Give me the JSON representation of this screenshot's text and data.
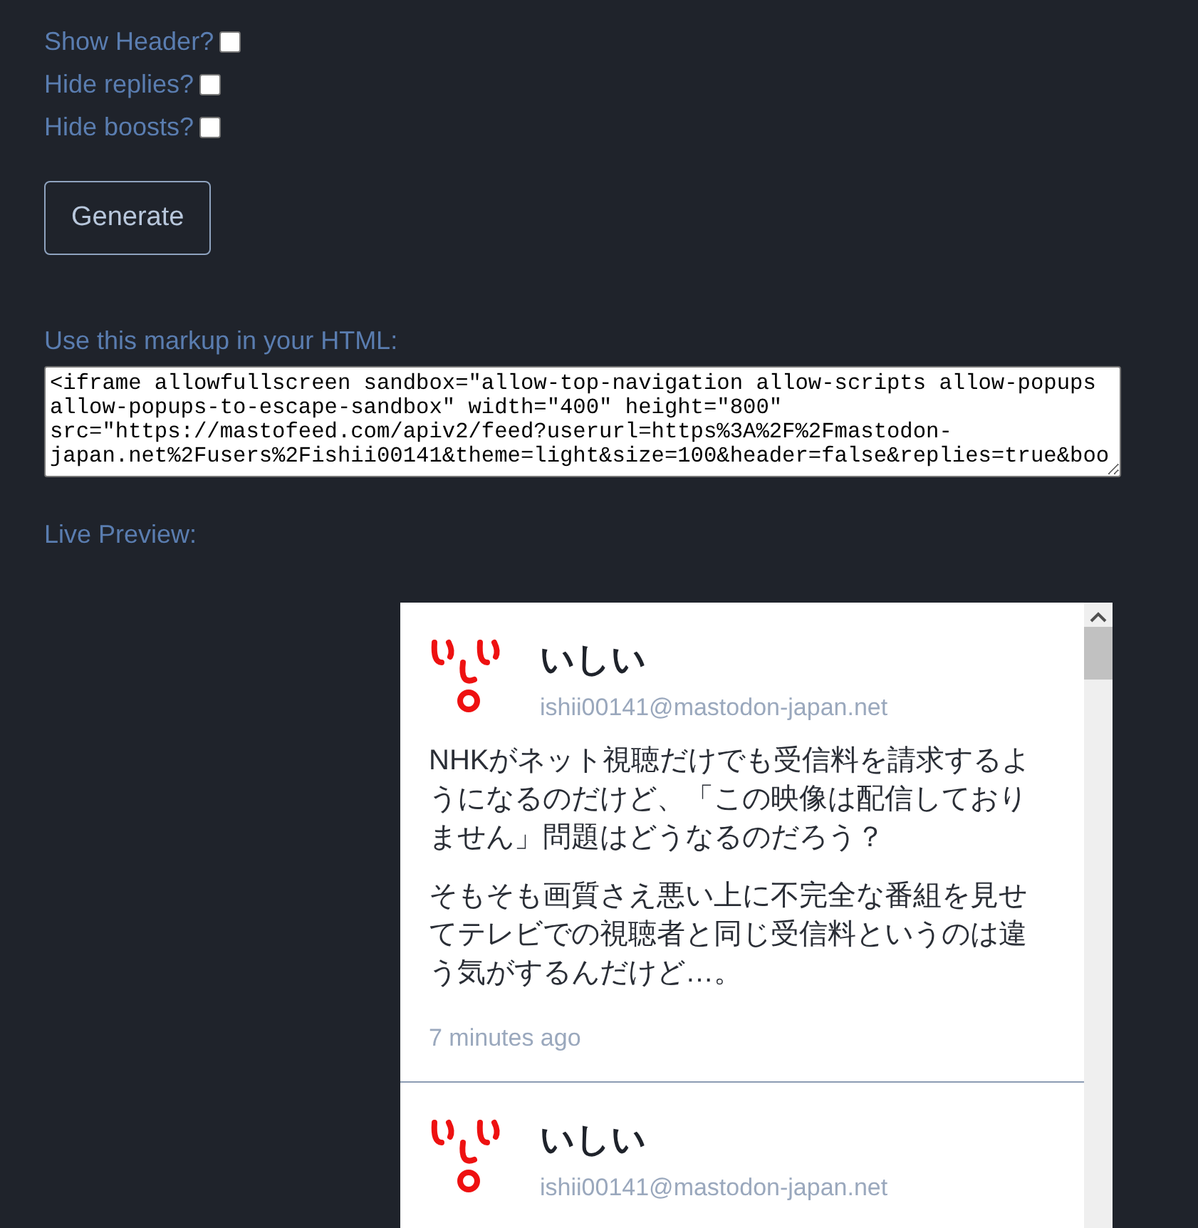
{
  "options": [
    {
      "label": "Show Header?",
      "checked": false
    },
    {
      "label": "Hide replies?",
      "checked": false
    },
    {
      "label": "Hide boosts?",
      "checked": false
    }
  ],
  "generate_button": "Generate",
  "markup": {
    "label": "Use this markup in your HTML:",
    "value": "<iframe allowfullscreen sandbox=\"allow-top-navigation allow-scripts allow-popups allow-popups-to-escape-sandbox\" width=\"400\" height=\"800\" src=\"https://mastofeed.com/apiv2/feed?userurl=https%3A%2F%2Fmastodon-japan.net%2Fusers%2Fishii00141&theme=light&size=100&header=false&replies=true&boo"
  },
  "preview": {
    "label": "Live Preview:",
    "posts": [
      {
        "name": "いしい",
        "handle": "ishii00141@mastodon-japan.net",
        "paragraphs": [
          "NHKがネット視聴だけでも受信料を請求するようになるのだけど、「この映像は配信しておりません」問題はどうなるのだろう？",
          "そもそも画質さえ悪い上に不完全な番組を見せてテレビでの視聴者と同じ受信料というのは違う気がするんだけど…。"
        ],
        "time": "7 minutes ago"
      },
      {
        "name": "いしい",
        "handle": "ishii00141@mastodon-japan.net"
      }
    ]
  }
}
